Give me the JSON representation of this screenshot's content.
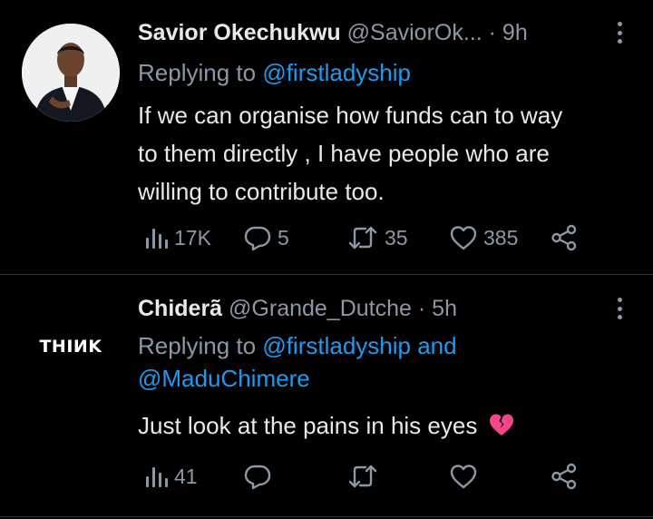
{
  "tweets": [
    {
      "author_name": "Savior Okechukwu",
      "author_handle": "@SaviorOk...",
      "dot": "·",
      "time": "9h",
      "replying_prefix": "Replying to ",
      "replying_to": "@firstladyship",
      "replying_and": "",
      "replying_to_2": "",
      "text_lines": [
        "If we can organise how funds can to way",
        "to them directly , I have people who are",
        "willing to contribute too."
      ],
      "views": "17K",
      "replies": "5",
      "retweets": "35",
      "likes": "385",
      "avatar": "man-in-suit-photo"
    },
    {
      "author_name": "Chiderã",
      "author_handle": "@Grande_Dutche",
      "dot": "·",
      "time": "5h",
      "replying_prefix": "Replying to ",
      "replying_to": "@firstladyship",
      "replying_and": " and",
      "replying_to_2": "@MaduChimere",
      "text_lines": [
        "Just look at the pains in his eyes"
      ],
      "emoji": "broken-heart-icon",
      "views": "41",
      "replies": "",
      "retweets": "",
      "likes": "",
      "avatar_text": "THIИK"
    }
  ],
  "colors": {
    "background": "#000000",
    "text": "#e7e9ea",
    "secondary": "#8b98a5",
    "link": "#1d9bf0",
    "divider": "#2f3336",
    "emoji": "#f4468c"
  },
  "icons": [
    "views-icon",
    "reply-icon",
    "retweet-icon",
    "like-icon",
    "share-icon",
    "more-icon"
  ]
}
